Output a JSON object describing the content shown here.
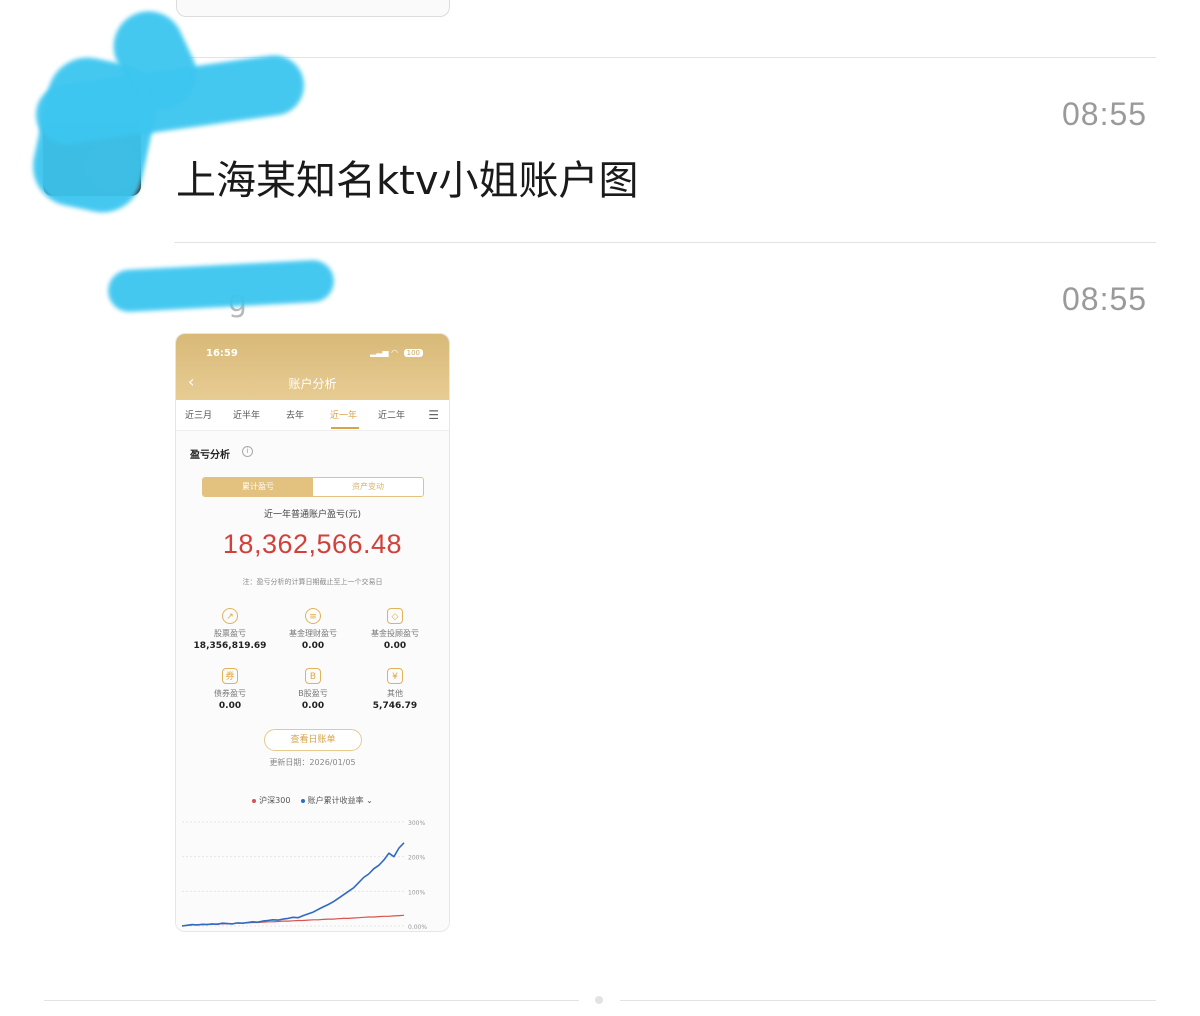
{
  "messages": [
    {
      "time": "08:55",
      "text": "上海某知名ktv小姐账户图"
    },
    {
      "time": "08:55",
      "sender_visible": "g"
    }
  ],
  "phone": {
    "status_time": "16:59",
    "battery": "100",
    "title": "账户分析",
    "tabs": [
      "近三月",
      "近半年",
      "去年",
      "近一年",
      "近二年"
    ],
    "active_tab": "近一年",
    "section_title": "盈亏分析",
    "segments": [
      "累计盈亏",
      "资产变动"
    ],
    "summary_label": "近一年普通账户盈亏(元)",
    "summary_value": "18,362,566.48",
    "note": "注：盈亏分析的计算日期截止至上一个交易日",
    "stats": [
      {
        "icon": "stock-icon",
        "label": "股票盈亏",
        "value": "18,356,819.69"
      },
      {
        "icon": "coins-icon",
        "label": "基金理财盈亏",
        "value": "0.00"
      },
      {
        "icon": "box-icon",
        "label": "基金投顾盈亏",
        "value": "0.00"
      },
      {
        "icon": "bond-icon",
        "label": "债券盈亏",
        "value": "0.00"
      },
      {
        "icon": "b-share-icon",
        "label": "B股盈亏",
        "value": "0.00"
      },
      {
        "icon": "yen-icon",
        "label": "其他",
        "value": "5,746.79"
      }
    ],
    "button_label": "查看日账单",
    "update_label": "更新日期：2026/01/05",
    "legend": [
      "沪深300",
      "账户累计收益率"
    ],
    "colors": {
      "hs300": "#d9534f",
      "account": "#2f6bc2",
      "gold": "#d7a44a",
      "value_red": "#d1413a"
    }
  },
  "chart_data": {
    "type": "line",
    "ytick_labels": [
      "300%",
      "200%",
      "100%",
      "0.00%"
    ],
    "ylim": [
      0,
      300
    ],
    "series": [
      {
        "name": "账户累计收益率",
        "values": [
          0,
          2,
          4,
          3,
          5,
          4,
          6,
          5,
          8,
          7,
          6,
          9,
          8,
          10,
          12,
          11,
          14,
          16,
          18,
          17,
          20,
          22,
          25,
          24,
          30,
          35,
          40,
          48,
          55,
          62,
          70,
          80,
          90,
          100,
          110,
          125,
          140,
          150,
          165,
          175,
          190,
          210,
          200,
          225,
          240
        ]
      },
      {
        "name": "沪深300",
        "values": [
          0,
          2,
          3,
          4,
          4,
          5,
          5,
          6,
          6,
          7,
          7,
          8,
          8,
          9,
          10,
          10,
          11,
          12,
          12,
          13,
          14,
          14,
          15,
          16,
          16,
          17,
          18,
          18,
          19,
          20,
          20,
          21,
          22,
          22,
          23,
          24,
          25,
          26,
          26,
          27,
          28,
          28,
          29,
          30,
          31
        ]
      }
    ]
  }
}
